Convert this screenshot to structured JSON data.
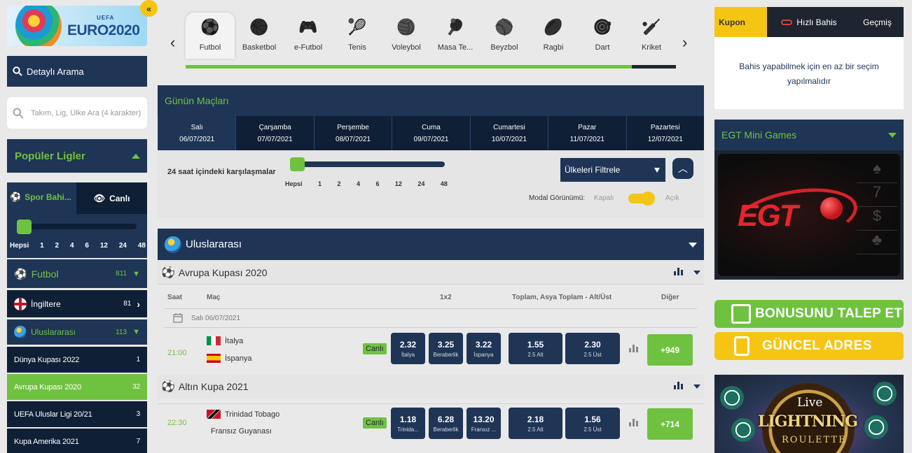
{
  "logo": {
    "brand": "EURO2020",
    "org": "UEFA"
  },
  "collapse_glyph": "«",
  "left": {
    "detail_search": "Detaylı Arama",
    "team_search_placeholder": "Takım, Lig, Ülke Ara (4 karakter)",
    "popular_leagues": "Popüler Ligler",
    "tab_sport": "Spor Bahi...",
    "tab_live": "Canlı",
    "range_ticks": [
      "Hepsi",
      "1",
      "2",
      "4",
      "6",
      "12",
      "24",
      "48"
    ],
    "futbol": {
      "label": "Futbol",
      "count": "811"
    },
    "england": {
      "label": "İngiltere",
      "count": "81"
    },
    "international": {
      "label": "Uluslararası",
      "count": "113"
    },
    "leagues": [
      {
        "label": "Dünya Kupası 2022",
        "count": "1"
      },
      {
        "label": "Avrupa Kupası 2020",
        "count": "32"
      },
      {
        "label": "UEFA Uluslar Ligi 20/21",
        "count": "3"
      },
      {
        "label": "Kupa Amerika 2021",
        "count": "7"
      }
    ]
  },
  "sports": [
    {
      "label": "Futbol",
      "icon": "soccer-ball-icon"
    },
    {
      "label": "Basketbol",
      "icon": "basketball-icon"
    },
    {
      "label": "e-Futbol",
      "icon": "gamepad-icon"
    },
    {
      "label": "Tenis",
      "icon": "tennis-racket-icon"
    },
    {
      "label": "Voleybol",
      "icon": "volleyball-icon"
    },
    {
      "label": "Masa Te...",
      "icon": "table-tennis-icon"
    },
    {
      "label": "Beyzbol",
      "icon": "baseball-icon"
    },
    {
      "label": "Ragbi",
      "icon": "rugby-ball-icon"
    },
    {
      "label": "Dart",
      "icon": "dart-icon"
    },
    {
      "label": "Kriket",
      "icon": "cricket-icon"
    }
  ],
  "sport_scroll_progress": 0.91,
  "today": {
    "title": "Günün Maçları",
    "days": [
      {
        "name": "Salı",
        "date": "06/07/2021"
      },
      {
        "name": "Çarşamba",
        "date": "07/07/2021"
      },
      {
        "name": "Perşembe",
        "date": "08/07/2021"
      },
      {
        "name": "Cuma",
        "date": "09/07/2021"
      },
      {
        "name": "Cumartesi",
        "date": "10/07/2021"
      },
      {
        "name": "Pazar",
        "date": "11/07/2021"
      },
      {
        "name": "Pazartesi",
        "date": "12/07/2021"
      }
    ],
    "range_label": "24 saat içindeki karşılaşmalar",
    "range_ticks": [
      "Hepsi",
      "1",
      "2",
      "4",
      "6",
      "12",
      "24",
      "48"
    ],
    "country_filter": "Ülkeleri Filtrele",
    "modal_label": "Modal Görünümü:",
    "modal_off": "Kapalı",
    "modal_on": "Açık"
  },
  "matches": {
    "section_title": "Uluslararası",
    "league1": "Avrupa Kupası 2020",
    "league2": "Altın Kupa 2021",
    "col_time": "Saat",
    "col_match": "Maç",
    "col_1x2": "1x2",
    "col_totals": "Toplam, Asya Toplam - Alt/Üst",
    "col_other": "Diğer",
    "date_row": "Salı 06/07/2021",
    "live_label": "Canlı",
    "m1": {
      "time": "21:00",
      "home": "İtalya",
      "away": "İspanya",
      "odds": [
        {
          "v": "2.32",
          "l": "İtalya"
        },
        {
          "v": "3.25",
          "l": "Beraberlik"
        },
        {
          "v": "3.22",
          "l": "İspanya"
        }
      ],
      "totals": [
        {
          "v": "1.55",
          "l": "2.5 Alt"
        },
        {
          "v": "2.30",
          "l": "2.5 Üst"
        }
      ],
      "more": "+949"
    },
    "m2": {
      "time": "22:30",
      "home": "Trinidad Tobago",
      "away": "Fransız Guyanası",
      "odds": [
        {
          "v": "1.18",
          "l": "Trinida..."
        },
        {
          "v": "6.28",
          "l": "Beraberlik"
        },
        {
          "v": "13.20",
          "l": "Fransız ..."
        }
      ],
      "totals": [
        {
          "v": "2.18",
          "l": "2.5 Alt"
        },
        {
          "v": "1.56",
          "l": "2.5 Üst"
        }
      ],
      "more": "+714"
    }
  },
  "coupon": {
    "tab_coupon": "Kupon",
    "tab_quick": "Hızlı Bahis",
    "tab_history": "Geçmiş",
    "message": "Bahis yapabilmek için en az bir seçim yapılmalıdır"
  },
  "egt": {
    "title": "EGT Mini Games",
    "logo": "EGT"
  },
  "bonus_button": "BONUSUNU TALEP ET",
  "address_button": "GÜNCEL ADRES",
  "casino": {
    "live": "Live",
    "title": "LIGHTNING",
    "sub": "ROULETTE"
  },
  "colors": {
    "navy": "#1f3556",
    "dark_navy": "#0f1f36",
    "green": "#6fc23f",
    "yellow": "#f6c514"
  }
}
